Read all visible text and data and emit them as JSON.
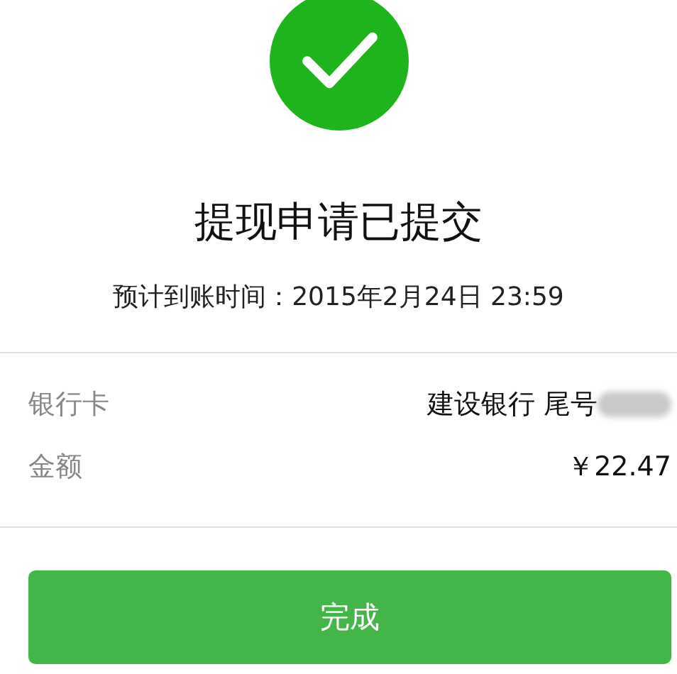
{
  "status": {
    "title": "提现申请已提交",
    "subtitle": "预计到账时间：2015年2月24日 23:59"
  },
  "details": [
    {
      "label": "银行卡",
      "value": "建设银行 尾号",
      "redacted": true
    },
    {
      "label": "金额",
      "value": "￥22.47",
      "redacted": false
    }
  ],
  "button": "完成"
}
